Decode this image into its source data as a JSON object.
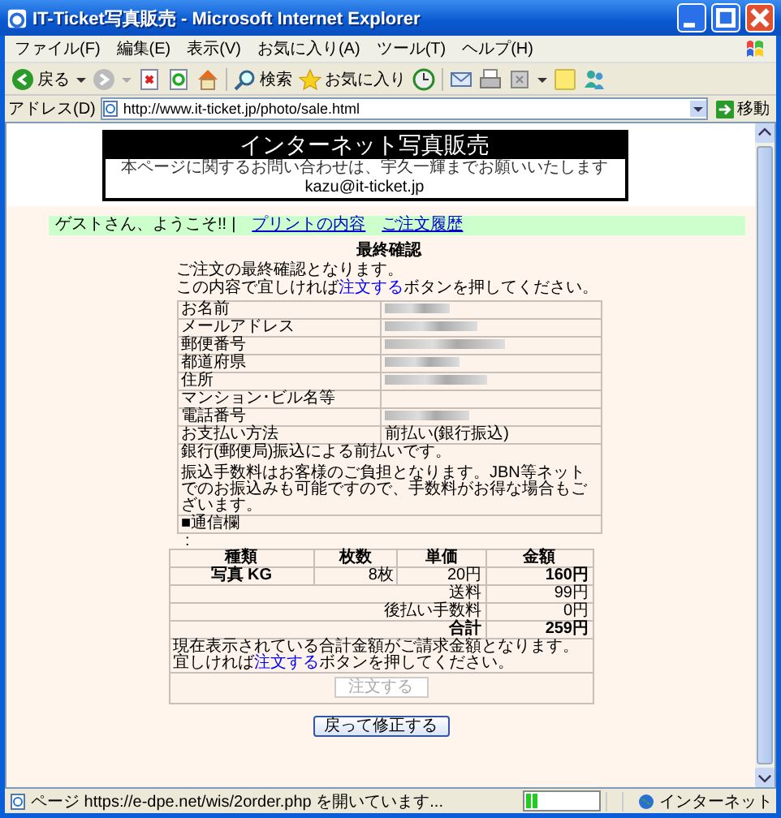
{
  "window": {
    "title": "IT-Ticket写真販売 - Microsoft Internet Explorer"
  },
  "menu": [
    "ファイル(F)",
    "編集(E)",
    "表示(V)",
    "お気に入り(A)",
    "ツール(T)",
    "ヘルプ(H)"
  ],
  "toolbar": {
    "back": "戻る",
    "search": "検索",
    "favorites": "お気に入り"
  },
  "address": {
    "label": "アドレス(D)",
    "url": "http://www.it-ticket.jp/photo/sale.html",
    "go": "移動"
  },
  "header": {
    "title": "インターネット写真販売",
    "notice": "本ページに関するお問い合わせは、宇久一輝までお願いいたします",
    "email": "kazu@it-ticket.jp"
  },
  "nav": {
    "greeting": "ゲストさん、ようこそ!!",
    "separator": "|",
    "links": [
      "プリントの内容",
      "ご注文履歴"
    ]
  },
  "confirm": {
    "title": "最終確認",
    "intro": "ご注文の最終確認となります。",
    "instruction": {
      "before": "この内容で宜しければ",
      "highlight": "注文する",
      "after": "ボタンを押してください。"
    },
    "fields": [
      {
        "label": "お名前",
        "redacted": true
      },
      {
        "label": "メールアドレス",
        "redacted": true
      },
      {
        "label": "郵便番号",
        "redacted": true
      },
      {
        "label": "都道府県",
        "redacted": true
      },
      {
        "label": "住所",
        "redacted": true
      },
      {
        "label": "マンション･ビル名等",
        "redacted": false
      },
      {
        "label": "電話番号",
        "redacted": true
      },
      {
        "label": "お支払い方法",
        "value": "前払い(銀行振込)"
      }
    ],
    "payment_note": [
      "銀行(郵便局)振込による前払いです。",
      "振込手数料はお客様のご負担となります。JBN等ネットでのお振込みも可能ですので、手数料がお得な場合もございます。"
    ],
    "message_label": "■通信欄"
  },
  "marker": ":",
  "order": {
    "columns": [
      "種類",
      "枚数",
      "単価",
      "金額"
    ],
    "items": [
      {
        "type": "写真 KG",
        "qty": "8枚",
        "price": "20円",
        "amount": "160円"
      }
    ],
    "summary": [
      {
        "label": "送料",
        "value": "99円",
        "bold": false
      },
      {
        "label": "後払い手数料",
        "value": "0円",
        "bold": false
      },
      {
        "label": "合計",
        "value": "259円",
        "bold": true
      }
    ],
    "notice": {
      "first": "現在表示されている合計金額がご請求金額となります。",
      "before": "宜しければ",
      "highlight": "注文する",
      "after": "ボタンを押してください。"
    },
    "submit": {
      "label": "注文する",
      "disabled": true
    }
  },
  "back_button": "戻って修正する",
  "status": {
    "text": "ページ https://e-dpe.net/wis/2order.php を開いています...",
    "level": 0.18,
    "zone": "インターネット"
  }
}
